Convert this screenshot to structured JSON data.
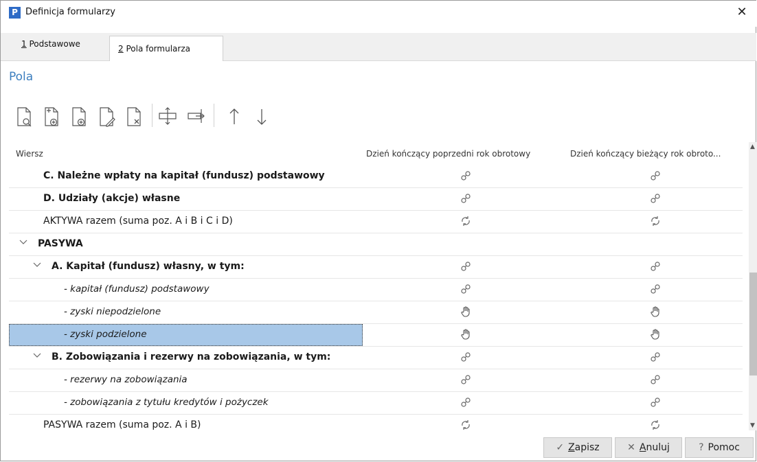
{
  "window": {
    "title": "Definicja formularzy",
    "close": "✕",
    "app_icon_letter": "P"
  },
  "tabs": [
    {
      "label": "1 Podstawowe",
      "key": "1",
      "rest": " Podstawowe"
    },
    {
      "label": "2 Pola formularza",
      "key": "2",
      "rest": " Pola formularza"
    }
  ],
  "section_title": "Pola",
  "toolbar": {
    "buttons": [
      "preview-icon",
      "add-from-template-icon",
      "add-icon",
      "edit-icon",
      "delete-icon",
      "move-row-icon",
      "move-right-icon",
      "arrow-up-icon",
      "arrow-down-icon"
    ]
  },
  "grid": {
    "columns": [
      "Wiersz",
      "Dzień kończący poprzedni rok obrotowy",
      "Dzień kończący bieżący rok obroto..."
    ],
    "rows": [
      {
        "label": "C. Należne wpłaty na kapitał (fundusz) podstawowy",
        "style": "bold",
        "indent": 1,
        "expand": false,
        "c1": "link-icon",
        "c2": "link-icon"
      },
      {
        "label": "D. Udziały (akcje) własne",
        "style": "bold",
        "indent": 1,
        "expand": false,
        "c1": "link-icon",
        "c2": "link-icon"
      },
      {
        "label": "AKTYWA razem (suma poz. A i B i C i D)",
        "style": "normal",
        "indent": 1,
        "expand": false,
        "c1": "refresh-icon",
        "c2": "refresh-icon"
      },
      {
        "label": "PASYWA",
        "style": "bold",
        "indent": 0,
        "expand": true,
        "c1": "",
        "c2": ""
      },
      {
        "label": "A. Kapitał (fundusz) własny, w tym:",
        "style": "bold",
        "indent": 1,
        "expand": true,
        "c1": "link-icon",
        "c2": "link-icon"
      },
      {
        "label": "- kapitał (fundusz) podstawowy",
        "style": "italic",
        "indent": 2,
        "expand": false,
        "c1": "link-icon",
        "c2": "link-icon"
      },
      {
        "label": "- zyski niepodzielone",
        "style": "italic",
        "indent": 2,
        "expand": false,
        "c1": "hand-icon",
        "c2": "hand-icon"
      },
      {
        "label": "- zyski podzielone",
        "style": "italic",
        "indent": 2,
        "expand": false,
        "c1": "hand-icon",
        "c2": "hand-icon",
        "selected": true
      },
      {
        "label": "B. Zobowiązania i rezerwy na zobowiązania, w tym:",
        "style": "bold",
        "indent": 1,
        "expand": true,
        "c1": "link-icon",
        "c2": "link-icon"
      },
      {
        "label": "- rezerwy na zobowiązania",
        "style": "italic",
        "indent": 2,
        "expand": false,
        "c1": "link-icon",
        "c2": "link-icon"
      },
      {
        "label": "- zobowiązania z tytułu kredytów i pożyczek",
        "style": "italic",
        "indent": 2,
        "expand": false,
        "c1": "link-icon",
        "c2": "link-icon"
      },
      {
        "label": "PASYWA razem (suma poz. A i B)",
        "style": "normal",
        "indent": 1,
        "expand": false,
        "c1": "refresh-icon",
        "c2": "refresh-icon"
      }
    ]
  },
  "footer": {
    "save": {
      "label": "Zapisz",
      "key": "Z",
      "rest": "apisz"
    },
    "cancel": {
      "label": "Anuluj",
      "key": "A",
      "rest": "nuluj"
    },
    "help": {
      "label": "Pomoc"
    }
  }
}
